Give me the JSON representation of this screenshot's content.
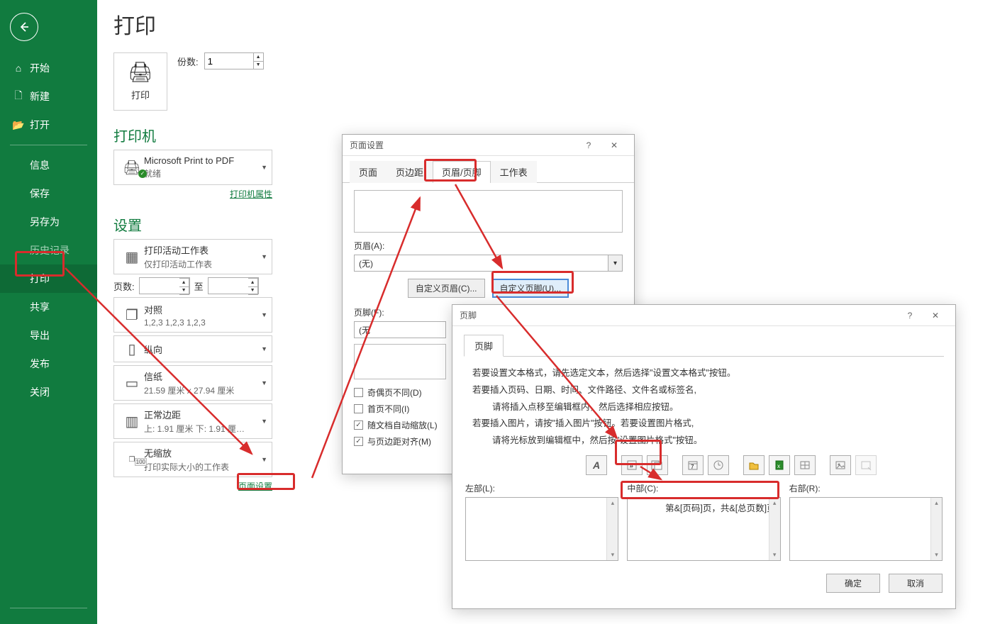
{
  "sidebar": {
    "back": "←",
    "items": [
      {
        "icon": "⌂",
        "label": "开始"
      },
      {
        "icon": "🗋",
        "label": "新建"
      },
      {
        "icon": "📂",
        "label": "打开"
      }
    ],
    "secondary": [
      {
        "label": "信息"
      },
      {
        "label": "保存"
      },
      {
        "label": "另存为"
      },
      {
        "label": "历史记录",
        "disabled": true
      },
      {
        "label": "打印",
        "selected": true
      },
      {
        "label": "共享"
      },
      {
        "label": "导出"
      },
      {
        "label": "发布"
      },
      {
        "label": "关闭"
      }
    ]
  },
  "print": {
    "title": "打印",
    "big_button": "打印",
    "printer_icon": "🖨",
    "copies_label": "份数:",
    "copies_value": "1",
    "printer_section": "打印机",
    "printer_name": "Microsoft Print to PDF",
    "printer_status": "就绪",
    "printer_props": "打印机属性",
    "settings_section": "设置",
    "opt_active": {
      "t1": "打印活动工作表",
      "t2": "仅打印活动工作表"
    },
    "pages_label": "页数:",
    "pages_from": "",
    "pages_to_label": "至",
    "pages_to": "",
    "collate": {
      "t1": "对照",
      "t2": "1,2,3    1,2,3    1,2,3"
    },
    "orient": {
      "t1": "纵向",
      "t2": ""
    },
    "paper": {
      "t1": "信纸",
      "t2": "21.59 厘米 x 27.94 厘米"
    },
    "margins": {
      "t1": "正常边距",
      "t2": "上: 1.91 厘米 下: 1.91 厘…"
    },
    "scale": {
      "t1": "无缩放",
      "t2": "打印实际大小的工作表",
      "badge": "100"
    },
    "page_setup_link": "页面设置"
  },
  "page_setup_dialog": {
    "title": "页面设置",
    "tabs": [
      "页面",
      "页边距",
      "页眉/页脚",
      "工作表"
    ],
    "active_tab": "页眉/页脚",
    "header_label": "页眉(A):",
    "header_value": "(无)",
    "custom_header_btn": "自定义页眉(C)...",
    "custom_footer_btn": "自定义页脚(U)...",
    "footer_label": "页脚(F):",
    "footer_value": "(无",
    "chk_odd_even": "奇偶页不同(D)",
    "chk_first": "首页不同(I)",
    "chk_scale": "随文档自动缩放(L)",
    "chk_align": "与页边距对齐(M)",
    "help_icon": "?",
    "close_icon": "✕"
  },
  "footer_dialog": {
    "title": "页脚",
    "help_icon": "?",
    "close_icon": "✕",
    "tab": "页脚",
    "help_lines": [
      "若要设置文本格式，请先选定文本，然后选择\"设置文本格式\"按钮。",
      "若要插入页码、日期、时间、文件路径、文件名或标签名,",
      "请将插入点移至编辑框内，然后选择相应按钮。",
      "若要插入图片，请按\"插入图片\"按钮。若要设置图片格式,",
      "请将光标放到编辑框中，然后按\"设置图片格式\"按钮。"
    ],
    "toolbar_icons": [
      "A",
      "#",
      "##",
      "📅",
      "🕐",
      "📁",
      "x",
      "🖼",
      "🖼",
      "⚙"
    ],
    "col_left": "左部(L):",
    "col_center": "中部(C):",
    "col_right": "右部(R):",
    "center_text": "第&[页码]页，共&[总页数]页",
    "ok": "确定",
    "cancel": "取消"
  }
}
